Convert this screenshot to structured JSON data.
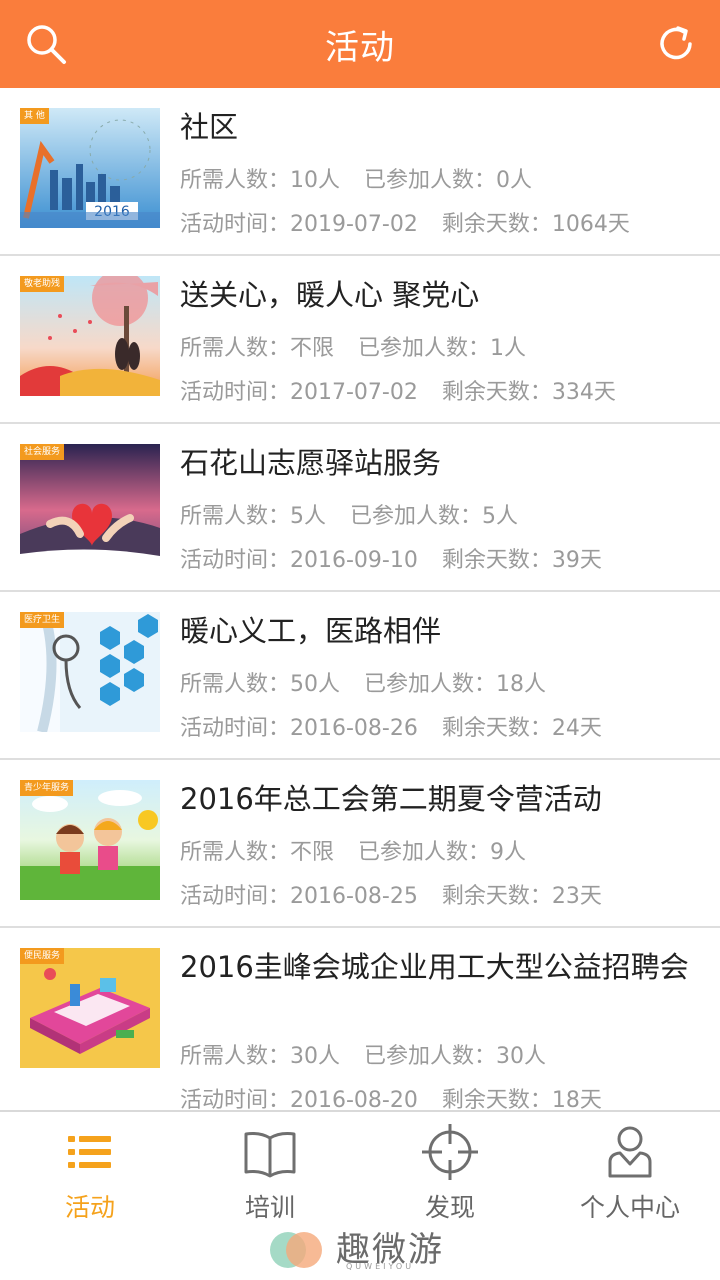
{
  "header": {
    "title": "活动",
    "search_icon": "search-icon",
    "refresh_icon": "refresh-icon"
  },
  "colors": {
    "accent": "#fa7d3c",
    "active_tab": "#f5a21c",
    "meta_text": "#9a9a9a"
  },
  "activities": [
    {
      "tag": "其 他",
      "title": "社区",
      "required": "所需人数：10人",
      "joined": "已参加人数：0人",
      "time": "活动时间：2019-07-02",
      "remaining": "剩余天数：1064天"
    },
    {
      "tag": "敬老助残",
      "title": "送关心，暖人心 聚党心",
      "required": "所需人数：不限",
      "joined": "已参加人数：1人",
      "time": "活动时间：2017-07-02",
      "remaining": "剩余天数：334天"
    },
    {
      "tag": "社会服务",
      "title": "石花山志愿驿站服务",
      "required": "所需人数：5人",
      "joined": "已参加人数：5人",
      "time": "活动时间：2016-09-10",
      "remaining": "剩余天数：39天"
    },
    {
      "tag": "医疗卫生",
      "title": "暖心义工，医路相伴",
      "required": "所需人数：50人",
      "joined": "已参加人数：18人",
      "time": "活动时间：2016-08-26",
      "remaining": "剩余天数：24天"
    },
    {
      "tag": "青少年服务",
      "title": "2016年总工会第二期夏令营活动",
      "required": "所需人数：不限",
      "joined": "已参加人数：9人",
      "time": "活动时间：2016-08-25",
      "remaining": "剩余天数：23天"
    },
    {
      "tag": "便民服务",
      "title": "2016圭峰会城企业用工大型公益招聘会",
      "required": "所需人数：30人",
      "joined": "已参加人数：30人",
      "time": "活动时间：2016-08-20",
      "remaining": "剩余天数：18天"
    }
  ],
  "tabs": [
    {
      "label": "活动",
      "icon": "list-icon",
      "active": true
    },
    {
      "label": "培训",
      "icon": "book-icon",
      "active": false
    },
    {
      "label": "发现",
      "icon": "crosshair-icon",
      "active": false
    },
    {
      "label": "个人中心",
      "icon": "user-icon",
      "active": false
    }
  ],
  "watermark": {
    "text": "趣微游",
    "sub": "QUWEIYOU"
  }
}
